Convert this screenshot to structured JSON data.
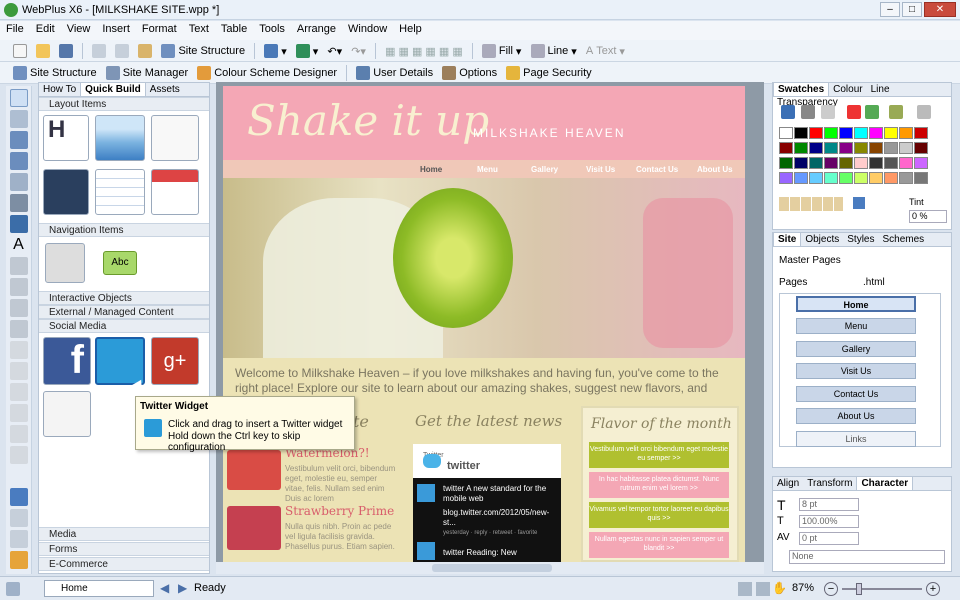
{
  "window": {
    "title": "WebPlus X6 - [MILKSHAKE SITE.wpp *]",
    "minimize": "–",
    "maximize": "□",
    "close": "✕"
  },
  "menu": [
    "File",
    "Edit",
    "View",
    "Insert",
    "Format",
    "Text",
    "Table",
    "Tools",
    "Arrange",
    "Window",
    "Help"
  ],
  "toolbar1": {
    "site_structure": "Site Structure",
    "fill": "Fill",
    "line": "Line",
    "text": "Text"
  },
  "toolbar2": {
    "site_structure": "Site Structure",
    "site_manager": "Site Manager",
    "colour_scheme": "Colour Scheme Designer",
    "user_details": "User Details",
    "options": "Options",
    "page_security": "Page Security"
  },
  "left_panel": {
    "tabs": [
      "How To",
      "Quick Build",
      "Assets"
    ],
    "sections": {
      "layout": "Layout Items",
      "navigation": "Navigation Items",
      "interactive": "Interactive Objects",
      "external": "External / Managed Content",
      "social": "Social Media",
      "media": "Media",
      "forms": "Forms",
      "ecommerce": "E-Commerce"
    },
    "abc": "Abc",
    "h": "H"
  },
  "tooltip": {
    "title": "Twitter Widget",
    "line1": "Click and drag to insert a Twitter widget",
    "line2": "Hold down the Ctrl key to skip configuration"
  },
  "site_page": {
    "logo": "Shake it up",
    "tagline": "MILKSHAKE HEAVEN",
    "nav": [
      "Home",
      "Menu",
      "Gallery",
      "Visit Us",
      "Contact Us",
      "About Us"
    ],
    "welcome": "Welcome to Milkshake Heaven – if you love milkshakes and having fun, you've come to the right place! Explore our site to learn about our amazing shakes, suggest new flavors, and have fun!",
    "col1_heading": "te",
    "item1_title": "Watermelon?!",
    "item1_text": "Vestibulum velit orci, bibendum eget, molestie eu, semper vitae, felis. Nullam sed enim Duis ac lorem",
    "item2_title": "Strawberry Prime",
    "item2_text": "Nulla quis nibh. Proin ac pede vel ligula facilisis gravida. Phasellus purus. Etiam sapien.",
    "news_heading": "Get the latest news",
    "twitter_label": "Twitter",
    "twitter_brand": "twitter",
    "tweet1": "twitter A new standard for the mobile web",
    "tweet1_link": "blog.twitter.com/2012/05/new-st...",
    "tweet1_meta": "yesterday · reply · retweet · favorite",
    "tweet2": "twitter Reading: New",
    "flavor_heading": "Flavor of the month",
    "flavors": [
      "Vestibulum velit orci bibendum eget molestie eu semper >>",
      "In hac habitasse platea dictumst. Nunc rutrum enim vel lorem >>",
      "Vivamus vel tempor tortor laoreet eu dapibus quis >>",
      "Nullam egestas nunc in sapien semper ut blandit >>"
    ]
  },
  "swatches": {
    "tabs": [
      "Swatches",
      "Colour",
      "Line",
      "Transparency"
    ],
    "tint_label": "Tint",
    "tint_value": "0 %"
  },
  "site_panel": {
    "tabs": [
      "Site",
      "Objects",
      "Styles",
      "Schemes"
    ],
    "master_pages": "Master Pages",
    "pages": "Pages",
    "html_ext": ".html",
    "pages_list": [
      "Home",
      "Menu",
      "Gallery",
      "Visit Us",
      "Contact Us",
      "About Us",
      "Links"
    ]
  },
  "character_panel": {
    "tabs": [
      "Align",
      "Transform",
      "Character"
    ],
    "font_size": "8 pt",
    "scale": "100.00%",
    "spacing": "0 pt",
    "none": "None"
  },
  "status": {
    "page": "Home",
    "ready": "Ready",
    "zoom": "87%"
  },
  "colors": {
    "pink": "#f4a7b5",
    "accent": "#b0c030"
  }
}
